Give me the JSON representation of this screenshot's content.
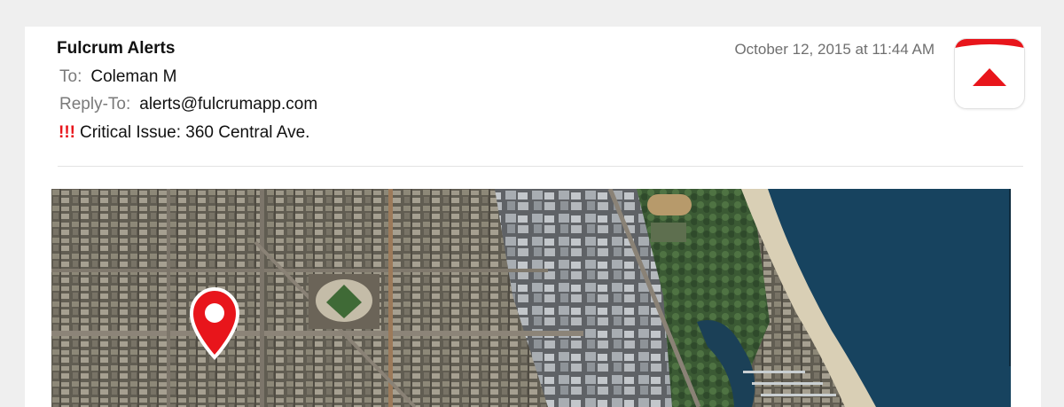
{
  "email": {
    "sender": "Fulcrum Alerts",
    "date": "October 12, 2015 at 11:44 AM",
    "to_label": "To:",
    "to_value": "Coleman M",
    "reply_to_label": "Reply-To:",
    "reply_to_value": "alerts@fulcrumapp.com",
    "priority_marker": "!!!",
    "subject": "Critical Issue: 360 Central Ave."
  },
  "icons": {
    "app_icon": "fulcrum-app-icon",
    "map_pin": "location-pin-icon"
  },
  "colors": {
    "accent_red": "#e8151b",
    "lake_blue": "#17435f",
    "beach_sand": "#d9cfb5"
  }
}
